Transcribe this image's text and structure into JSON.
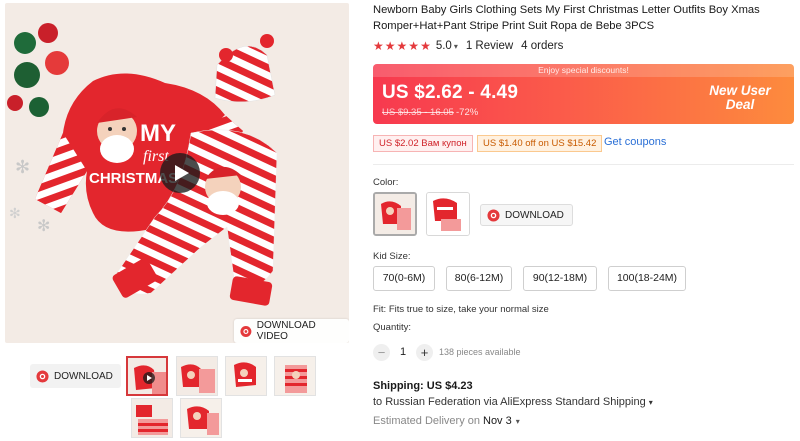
{
  "product": {
    "title": "Newborn Baby Girls Clothing Sets My First Christmas Letter Outfits Boy Xmas Romper+Hat+Pant Stripe Print Suit Ropa de Bebe 3PCS",
    "image_text": {
      "line1": "MY",
      "line2": "first",
      "line3": "CHRISTMAS"
    }
  },
  "rating": {
    "stars": 5,
    "value": "5.0",
    "reviews": "1 Review",
    "orders": "4 orders"
  },
  "price": {
    "promo_banner": "Enjoy special discounts!",
    "current": "US $2.62 - 4.49",
    "original": "US $9.35 - 16.05",
    "discount": "-72%",
    "new_user": "New User Deal"
  },
  "coupons": {
    "coupon1": "US $2.02 Вам купон",
    "coupon2": "US $1.40 off on US $15.42",
    "get_link": "Get coupons"
  },
  "color": {
    "label": "Color:",
    "download": "DOWNLOAD"
  },
  "kid_size": {
    "label": "Kid Size:",
    "options": [
      "70(0-6M)",
      "80(6-12M)",
      "90(12-18M)",
      "100(18-24M)"
    ]
  },
  "fit": {
    "text": "Fit: Fits true to size, take your normal size"
  },
  "quantity": {
    "label": "Quantity:",
    "minus": "−",
    "plus": "+",
    "value": "1",
    "available": "138 pieces available"
  },
  "shipping": {
    "title": "Shipping: US $4.23",
    "route": "to Russian Federation via AliExpress Standard Shipping",
    "delivery_label": "Estimated Delivery on",
    "delivery_date": "Nov 3"
  },
  "gallery": {
    "download_video": "DOWNLOAD VIDEO",
    "download": "DOWNLOAD"
  },
  "colors": {
    "accent": "#e4393c",
    "link": "#2a6fd6",
    "banner_from": "#f7394f",
    "banner_to": "#fd8b3d"
  }
}
